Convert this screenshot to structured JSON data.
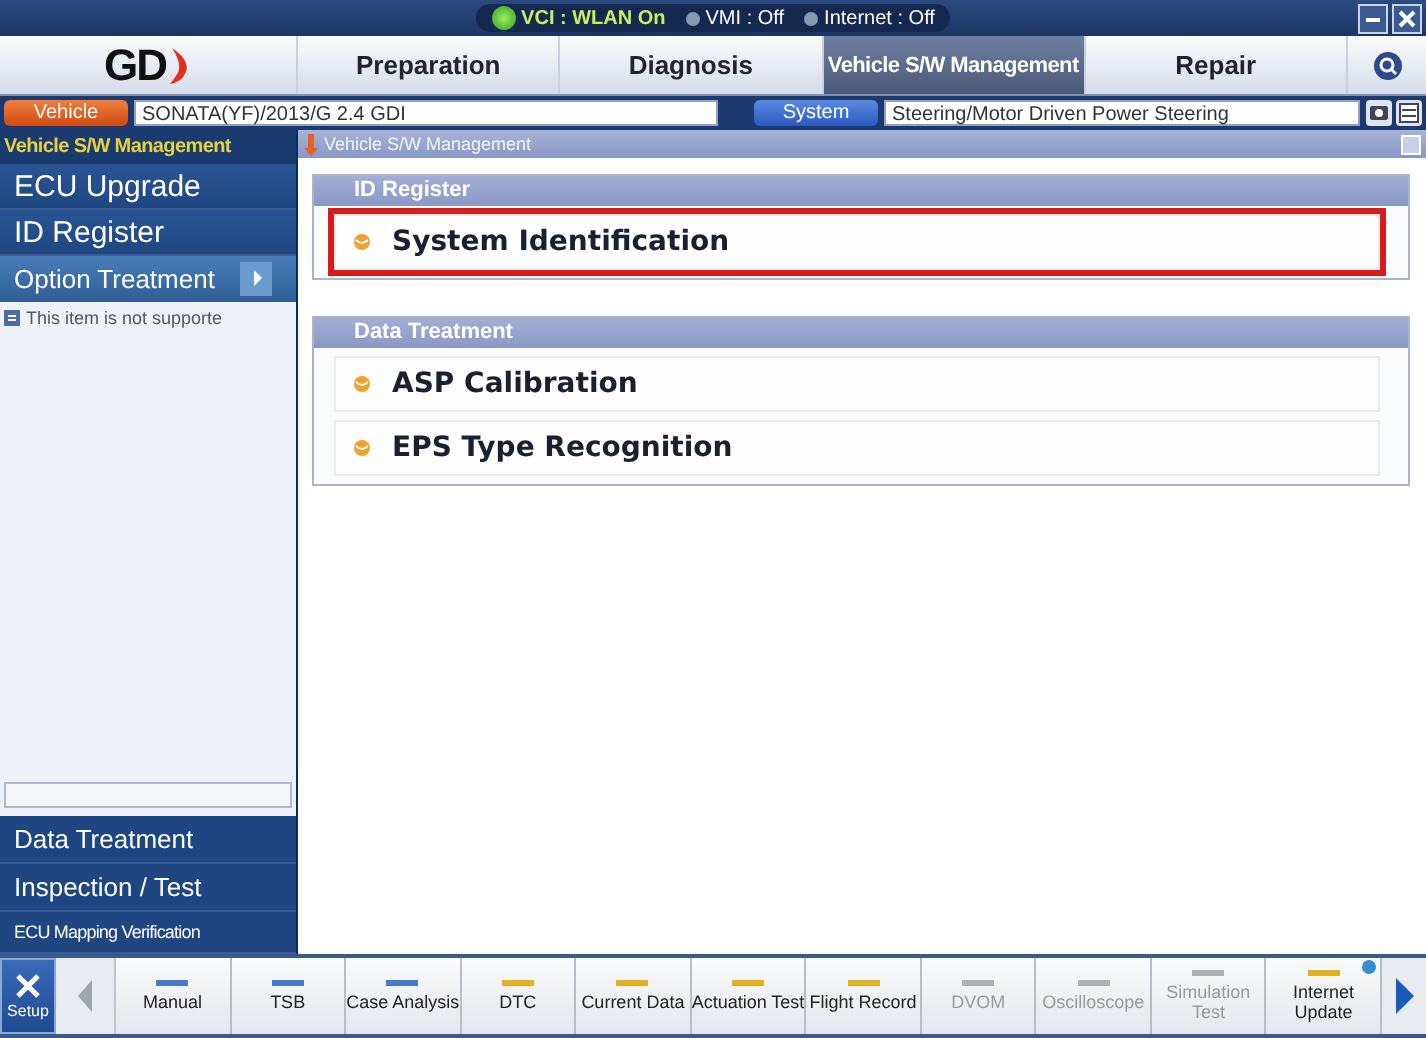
{
  "status_bar": {
    "items": [
      {
        "label": "VCI : WLAN On",
        "on": true
      },
      {
        "label": "VMI : Off",
        "on": false
      },
      {
        "label": "Internet : Off",
        "on": false
      }
    ]
  },
  "logo": {
    "text": "GD"
  },
  "tabs": [
    {
      "label": "Preparation",
      "selected": false
    },
    {
      "label": "Diagnosis",
      "selected": false
    },
    {
      "label": "Vehicle S/W Management",
      "selected": true
    },
    {
      "label": "Repair",
      "selected": false
    }
  ],
  "vehicle_bar": {
    "vehicle_button": "Vehicle",
    "vehicle": "SONATA(YF)/2013/G 2.4 GDI",
    "system_button": "System",
    "system": "Steering/Motor Driven Power Steering"
  },
  "sidebar": {
    "title": "Vehicle S/W Management",
    "items": [
      {
        "label": "ECU Upgrade",
        "selected": false
      },
      {
        "label": "ID Register",
        "selected": false
      },
      {
        "label": "Option Treatment",
        "selected": true
      }
    ],
    "note": "This item is not supporte",
    "bottom_items": [
      {
        "label": "Data Treatment",
        "kind": "large"
      },
      {
        "label": "Inspection / Test",
        "kind": "large"
      },
      {
        "label": "ECU Mapping Verification",
        "kind": "small"
      }
    ]
  },
  "main": {
    "breadcrumb": "Vehicle S/W Management",
    "sections": [
      {
        "title": "ID Register",
        "items": [
          {
            "label": "System Identification",
            "highlighted": true
          }
        ]
      },
      {
        "title": "Data Treatment",
        "items": [
          {
            "label": "ASP Calibration",
            "highlighted": false
          },
          {
            "label": "EPS Type Recognition",
            "highlighted": false
          }
        ]
      }
    ]
  },
  "toolbar": {
    "setup": "Setup",
    "items": [
      {
        "label": "Manual",
        "color": "#4a78c8",
        "disabled": false,
        "badge": false
      },
      {
        "label": "TSB",
        "color": "#4a78c8",
        "disabled": false,
        "badge": false
      },
      {
        "label": "Case Analysis",
        "color": "#4a78c8",
        "disabled": false,
        "badge": false
      },
      {
        "label": "DTC",
        "color": "#e0b020",
        "disabled": false,
        "badge": false
      },
      {
        "label": "Current Data",
        "color": "#e0b020",
        "disabled": false,
        "badge": false
      },
      {
        "label": "Actuation Test",
        "color": "#e0b020",
        "disabled": false,
        "badge": false
      },
      {
        "label": "Flight Record",
        "color": "#e0b020",
        "disabled": false,
        "badge": false
      },
      {
        "label": "DVOM",
        "color": "#b0b0b0",
        "disabled": true,
        "badge": false
      },
      {
        "label": "Oscilloscope",
        "color": "#b0b0b0",
        "disabled": true,
        "badge": false
      },
      {
        "label": "Simulation Test",
        "color": "#b0b0b0",
        "disabled": true,
        "badge": false
      },
      {
        "label": "Internet Update",
        "color": "#e0b020",
        "disabled": false,
        "badge": true
      }
    ]
  }
}
